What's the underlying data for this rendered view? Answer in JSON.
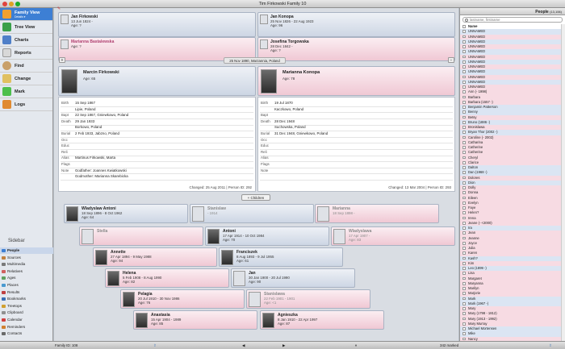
{
  "window": {
    "title": "Tim Firkowski Family 10"
  },
  "nav": {
    "family_view": "Family View",
    "family_view_sub": "Details ▾",
    "tree_view": "Tree View",
    "charts": "Charts",
    "reports": "Reports",
    "find": "Find",
    "change": "Change",
    "mark": "Mark",
    "logs": "Logs"
  },
  "sidebar": {
    "title": "Sidebar",
    "items": [
      "People",
      "Sources",
      "Multimedia",
      "Relatives",
      "Ages",
      "Places",
      "Results",
      "Bookmarks",
      "Treetops",
      "Clipboard",
      "Calendar",
      "Reminders",
      "Contacts"
    ]
  },
  "parents": {
    "gf1": {
      "name": "Jan Firkowski",
      "l1": "13 Jun 1824 -",
      "l2": "Age: ?"
    },
    "gf2": {
      "name": "Jan Konopa",
      "l1": "25 Nov 1826 - 22 Aug 1923",
      "l2": "Age: 96"
    },
    "gm1": {
      "name": "Marianna Bastalewska",
      "l1": "Age: ?"
    },
    "gm2": {
      "name": "Josefina Torgowska",
      "l1": "28 Dec 1842 -",
      "l2": "Age: ?"
    }
  },
  "marriage": "25 Nov 1890, Marzannia, Poland",
  "husband": {
    "name": "Marcin Firkowski",
    "age": "Age: 65",
    "rows": [
      {
        "label": "Birth",
        "value": "15 Sep 1867"
      },
      {
        "label": "",
        "value": "Lipie, Poland"
      },
      {
        "label": "Bapt",
        "value": "22 Sep 1867, Gniewkowo, Poland"
      },
      {
        "label": "Death",
        "value": "29 Jan 1933"
      },
      {
        "label": "",
        "value": "Borkowo, Poland"
      },
      {
        "label": "Burial",
        "value": "2 Feb 1933, Jabzno, Poland"
      },
      {
        "label": "Occ",
        "value": ""
      },
      {
        "label": "Educ",
        "value": ""
      },
      {
        "label": "Reli",
        "value": ""
      },
      {
        "label": "Alias",
        "value": "Martinus Firkowski, Marta"
      },
      {
        "label": "Flags",
        "value": ""
      },
      {
        "label": "Note",
        "value": "Godfather: Joannes Kwiatkowski"
      },
      {
        "label": "",
        "value": "Godmother: Marianna Skarebicka"
      }
    ],
    "changed": "Changed: 25 Aug 2011 | Person ID: 292"
  },
  "wife": {
    "name": "Marianna Konopa",
    "age": "Age: 78",
    "rows": [
      {
        "label": "Birth",
        "value": "19 Jul 1870"
      },
      {
        "label": "",
        "value": "Kaczkowo, Poland"
      },
      {
        "label": "Bapt",
        "value": ""
      },
      {
        "label": "Death",
        "value": "28 Dec 1948"
      },
      {
        "label": "",
        "value": "Suchowska, Poland"
      },
      {
        "label": "Burial",
        "value": "31 Dec 1948, Gniewkowo, Poland"
      },
      {
        "label": "Occ",
        "value": ""
      },
      {
        "label": "Educ",
        "value": ""
      },
      {
        "label": "Reli",
        "value": ""
      },
      {
        "label": "Alias",
        "value": ""
      },
      {
        "label": "Flags",
        "value": ""
      },
      {
        "label": "Note",
        "value": ""
      },
      {
        "label": "",
        "value": ""
      }
    ],
    "changed": "Changed: 13 Mar 2004 | Person ID: 293"
  },
  "children_button": "+ Children",
  "children": [
    {
      "name": "Wladyslaw Antoni",
      "l1": "18 Sep 1896 - 8 Oct 1962",
      "l2": "Age: 64",
      "sex": "m",
      "photo": "img"
    },
    {
      "name": "Stanislaw",
      "l1": "- 1914",
      "l2": "",
      "sex": "m",
      "photo": "sil",
      "dim": true
    },
    {
      "name": "Marianna",
      "l1": "18 Sep 1898 -",
      "l2": "",
      "sex": "f",
      "photo": "sil",
      "dim": true
    },
    {
      "name": "Stella",
      "l1": "",
      "l2": "",
      "sex": "f",
      "photo": "sil",
      "dim": true
    },
    {
      "name": "Antoni",
      "l1": "17 Apr 1914 - 10 Oct 1984",
      "l2": "Age: 70",
      "sex": "m",
      "photo": "img"
    },
    {
      "name": "Wladyslawa",
      "l1": "17 Apr 1907 -",
      "l2": "Age: 83",
      "sex": "f",
      "photo": "sil",
      "dim": true
    },
    {
      "name": "Annette",
      "l1": "27 Apr 1894 - 9 May 1988",
      "l2": "Age: 94",
      "sex": "f",
      "photo": "img"
    },
    {
      "name": "Franciszek",
      "l1": "8 Aug 1893 - 9 Jul 1955",
      "l2": "Age: 61",
      "sex": "m",
      "photo": "img"
    },
    {
      "name": "Helena",
      "l1": "5 Feb 1908 - 8 Aug 1990",
      "l2": "Age: 82",
      "sex": "f",
      "photo": "img"
    },
    {
      "name": "Jan",
      "l1": "30 Jan 1900 - 20 Jul 1990",
      "l2": "Age: 90",
      "sex": "m",
      "photo": "sil"
    },
    {
      "name": "Pelagia",
      "l1": "20 Jul 1910 - 30 Nov 1986",
      "l2": "Age: 76",
      "sex": "f",
      "photo": "img"
    },
    {
      "name": "Stanislawa",
      "l1": "22 Feb 1901 - 1901",
      "l2": "Age: <1",
      "sex": "f",
      "photo": "sil",
      "dim": true
    },
    {
      "name": "Anastasia",
      "l1": "15 Apr 1904 - 1989",
      "l2": "Age: 85",
      "sex": "f",
      "photo": "img"
    },
    {
      "name": "Agnieszka",
      "l1": "8 Jan 1910 - 22 Apr 1997",
      "l2": "Age: 87",
      "sex": "f",
      "photo": "img"
    }
  ],
  "footer": {
    "family_id": "Family ID: 108",
    "marked": "342 marked"
  },
  "people_panel": {
    "title": "People",
    "count": "(13,106)",
    "search_placeholder": "lastname, firstname",
    "header": "Name",
    "list": [
      [
        "UNNAMED",
        "m"
      ],
      [
        "UNNAMED",
        "f"
      ],
      [
        "UNNAMED",
        "m"
      ],
      [
        "UNNAMED",
        "f"
      ],
      [
        "UNNAMED",
        "m"
      ],
      [
        "UNNAMED",
        "f"
      ],
      [
        "UNNAMED",
        "m"
      ],
      [
        "UNNAMED",
        "f"
      ],
      [
        "UNNAMED",
        "m"
      ],
      [
        "UNNAMED",
        "f"
      ],
      [
        "UNNAMED",
        "m"
      ],
      [
        "UNNAMED",
        "f"
      ],
      [
        "Ann (- 1998)",
        "f"
      ],
      [
        "Barbara",
        "f"
      ],
      [
        "Barbara (1557 -)",
        "f"
      ],
      [
        "Benjamin Patterson",
        "m"
      ],
      [
        "Benny",
        "m"
      ],
      [
        "Betsy",
        "f"
      ],
      [
        "Bruno (1886 -)",
        "m"
      ],
      [
        "Bronislawa",
        "f"
      ],
      [
        "Bryan Thor (2002 -)",
        "m"
      ],
      [
        "Caroline (- 2002)",
        "f"
      ],
      [
        "Catharina",
        "f"
      ],
      [
        "Catherine",
        "f"
      ],
      [
        "Catherine",
        "f"
      ],
      [
        "Cheryl",
        "f"
      ],
      [
        "Clarice",
        "f"
      ],
      [
        "Dalton",
        "m"
      ],
      [
        "Dan (1968 -)",
        "m"
      ],
      [
        "Dolores",
        "f"
      ],
      [
        "Dion",
        "m"
      ],
      [
        "Dolly",
        "f"
      ],
      [
        "Donna",
        "f"
      ],
      [
        "Eileen",
        "f"
      ],
      [
        "Evelyn",
        "f"
      ],
      [
        "Faye",
        "f"
      ],
      [
        "Helen?",
        "f"
      ],
      [
        "Irena",
        "f"
      ],
      [
        "Jeane (- <2000)",
        "f"
      ],
      [
        "Ira",
        "m"
      ],
      [
        "Jean",
        "f"
      ],
      [
        "Jeanne",
        "f"
      ],
      [
        "Joyce",
        "f"
      ],
      [
        "Julia",
        "f"
      ],
      [
        "Karen",
        "f"
      ],
      [
        "Kash?",
        "m"
      ],
      [
        "Kim",
        "f"
      ],
      [
        "Leo (1899 -)",
        "m"
      ],
      [
        "Lisa",
        "f"
      ],
      [
        "Margaret",
        "f"
      ],
      [
        "Maryanna",
        "f"
      ],
      [
        "Marilyn",
        "f"
      ],
      [
        "Marjorie",
        "f"
      ],
      [
        "Mark",
        "m"
      ],
      [
        "Mark (1967 -)",
        "m"
      ],
      [
        "Mary",
        "f"
      ],
      [
        "Mary (1798 - 1812)",
        "f"
      ],
      [
        "Mary (1913 - 1992)",
        "f"
      ],
      [
        "Mary Murray",
        "f"
      ],
      [
        "Michael Mortensen",
        "m"
      ],
      [
        "Mike",
        "m"
      ],
      [
        "Nancy",
        "f"
      ],
      [
        "Nellie (1816 - 1887)",
        "f"
      ],
      [
        "Olga Frottag (1904 -)",
        "f"
      ],
      [
        "Pam",
        "f"
      ]
    ]
  }
}
